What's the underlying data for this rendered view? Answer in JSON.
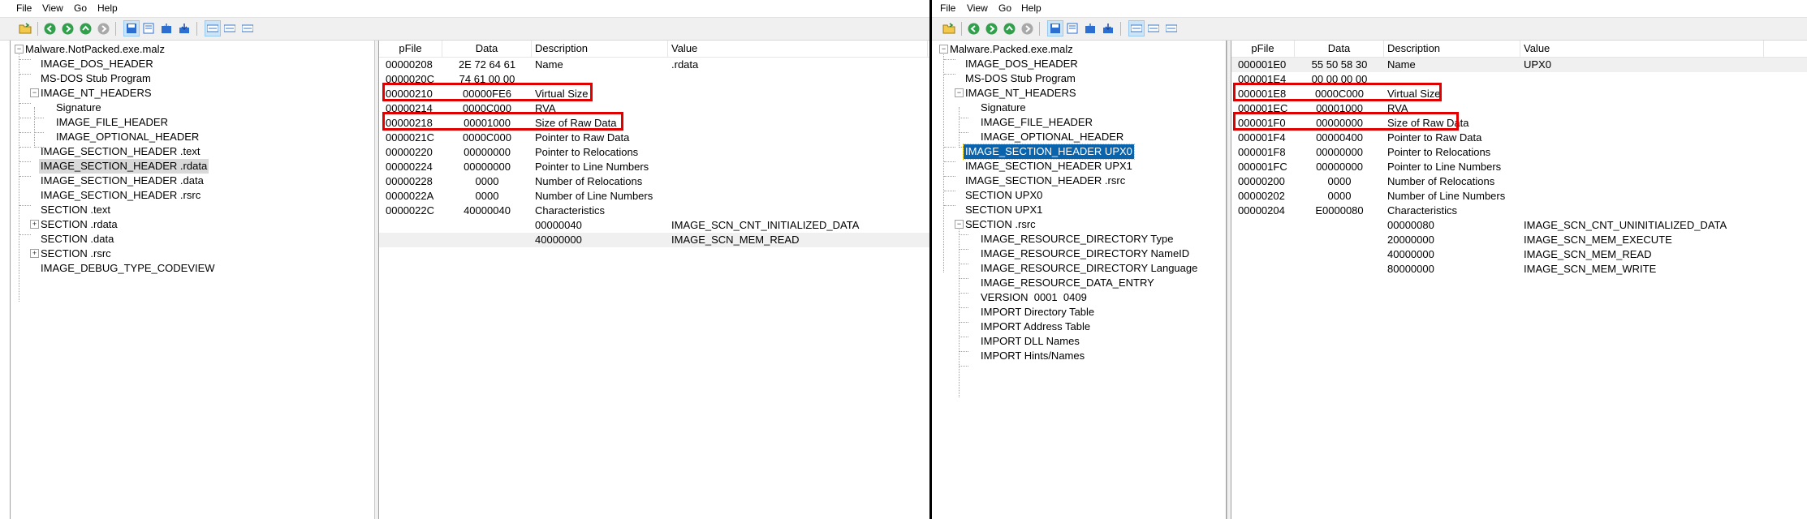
{
  "left": {
    "menu": [
      "File",
      "View",
      "Go",
      "Help"
    ],
    "tree": [
      {
        "label": "Malware.NotPacked.exe.malz",
        "level": 0,
        "expander": "−"
      },
      {
        "label": "IMAGE_DOS_HEADER",
        "level": 1
      },
      {
        "label": "MS-DOS Stub Program",
        "level": 1
      },
      {
        "label": "IMAGE_NT_HEADERS",
        "level": 1,
        "expander": "−"
      },
      {
        "label": "Signature",
        "level": 2
      },
      {
        "label": "IMAGE_FILE_HEADER",
        "level": 2
      },
      {
        "label": "IMAGE_OPTIONAL_HEADER",
        "level": 2
      },
      {
        "label": "IMAGE_SECTION_HEADER .text",
        "level": 1
      },
      {
        "label": "IMAGE_SECTION_HEADER .rdata",
        "level": 1
      },
      {
        "label": "IMAGE_SECTION_HEADER .data",
        "level": 1
      },
      {
        "label": "IMAGE_SECTION_HEADER .rsrc",
        "level": 1
      },
      {
        "label": "SECTION .text",
        "level": 1
      },
      {
        "label": "SECTION .rdata",
        "level": 1,
        "expander": "+"
      },
      {
        "label": "SECTION .data",
        "level": 1
      },
      {
        "label": "SECTION .rsrc",
        "level": 1,
        "expander": "+"
      },
      {
        "label": "IMAGE_DEBUG_TYPE_CODEVIEW",
        "level": 1
      }
    ],
    "columns": [
      "pFile",
      "Data",
      "Description",
      "Value"
    ],
    "rows": [
      {
        "pfile": "00000208",
        "data": "2E 72 64 61",
        "desc": "Name",
        "value": ".rdata"
      },
      {
        "pfile": "0000020C",
        "data": "74 61 00 00",
        "desc": "",
        "value": ""
      },
      {
        "pfile": "00000210",
        "data": "00000FE6",
        "desc": "Virtual Size",
        "value": ""
      },
      {
        "pfile": "00000214",
        "data": "0000C000",
        "desc": "RVA",
        "value": ""
      },
      {
        "pfile": "00000218",
        "data": "00001000",
        "desc": "Size of Raw Data",
        "value": ""
      },
      {
        "pfile": "0000021C",
        "data": "0000C000",
        "desc": "Pointer to Raw Data",
        "value": ""
      },
      {
        "pfile": "00000220",
        "data": "00000000",
        "desc": "Pointer to Relocations",
        "value": ""
      },
      {
        "pfile": "00000224",
        "data": "00000000",
        "desc": "Pointer to Line Numbers",
        "value": ""
      },
      {
        "pfile": "00000228",
        "data": "0000",
        "desc": "Number of Relocations",
        "value": ""
      },
      {
        "pfile": "0000022A",
        "data": "0000",
        "desc": "Number of Line Numbers",
        "value": ""
      },
      {
        "pfile": "0000022C",
        "data": "40000040",
        "desc": "Characteristics",
        "value": ""
      },
      {
        "pfile": "",
        "data": "",
        "desc": "00000040",
        "value": "IMAGE_SCN_CNT_INITIALIZED_DATA"
      },
      {
        "pfile": "",
        "data": "",
        "desc": "40000000",
        "value": "IMAGE_SCN_MEM_READ"
      }
    ]
  },
  "right": {
    "menu": [
      "File",
      "View",
      "Go",
      "Help"
    ],
    "tree": [
      {
        "label": "Malware.Packed.exe.malz",
        "level": 0,
        "expander": "−"
      },
      {
        "label": "IMAGE_DOS_HEADER",
        "level": 1
      },
      {
        "label": "MS-DOS Stub Program",
        "level": 1
      },
      {
        "label": "IMAGE_NT_HEADERS",
        "level": 1,
        "expander": "−"
      },
      {
        "label": "Signature",
        "level": 2
      },
      {
        "label": "IMAGE_FILE_HEADER",
        "level": 2
      },
      {
        "label": "IMAGE_OPTIONAL_HEADER",
        "level": 2
      },
      {
        "label": "IMAGE_SECTION_HEADER UPX0",
        "level": 1
      },
      {
        "label": "IMAGE_SECTION_HEADER UPX1",
        "level": 1
      },
      {
        "label": "IMAGE_SECTION_HEADER .rsrc",
        "level": 1
      },
      {
        "label": "SECTION UPX0",
        "level": 1
      },
      {
        "label": "SECTION UPX1",
        "level": 1
      },
      {
        "label": "SECTION .rsrc",
        "level": 1,
        "expander": "−"
      },
      {
        "label": "IMAGE_RESOURCE_DIRECTORY Type",
        "level": 2
      },
      {
        "label": "IMAGE_RESOURCE_DIRECTORY NameID",
        "level": 2
      },
      {
        "label": "IMAGE_RESOURCE_DIRECTORY Language",
        "level": 2
      },
      {
        "label": "IMAGE_RESOURCE_DATA_ENTRY",
        "level": 2
      },
      {
        "label": "VERSION  0001  0409",
        "level": 2
      },
      {
        "label": "IMPORT Directory Table",
        "level": 2
      },
      {
        "label": "IMPORT Address Table",
        "level": 2
      },
      {
        "label": "IMPORT DLL Names",
        "level": 2
      },
      {
        "label": "IMPORT Hints/Names",
        "level": 2
      }
    ],
    "columns": [
      "pFile",
      "Data",
      "Description",
      "Value"
    ],
    "rows": [
      {
        "pfile": "000001E0",
        "data": "55 50 58 30",
        "desc": "Name",
        "value": "UPX0"
      },
      {
        "pfile": "000001E4",
        "data": "00 00 00 00",
        "desc": "",
        "value": ""
      },
      {
        "pfile": "000001E8",
        "data": "0000C000",
        "desc": "Virtual Size",
        "value": ""
      },
      {
        "pfile": "000001EC",
        "data": "00001000",
        "desc": "RVA",
        "value": ""
      },
      {
        "pfile": "000001F0",
        "data": "00000000",
        "desc": "Size of Raw Data",
        "value": ""
      },
      {
        "pfile": "000001F4",
        "data": "00000400",
        "desc": "Pointer to Raw Data",
        "value": ""
      },
      {
        "pfile": "000001F8",
        "data": "00000000",
        "desc": "Pointer to Relocations",
        "value": ""
      },
      {
        "pfile": "000001FC",
        "data": "00000000",
        "desc": "Pointer to Line Numbers",
        "value": ""
      },
      {
        "pfile": "00000200",
        "data": "0000",
        "desc": "Number of Relocations",
        "value": ""
      },
      {
        "pfile": "00000202",
        "data": "0000",
        "desc": "Number of Line Numbers",
        "value": ""
      },
      {
        "pfile": "00000204",
        "data": "E0000080",
        "desc": "Characteristics",
        "value": ""
      },
      {
        "pfile": "",
        "data": "",
        "desc": "00000080",
        "value": "IMAGE_SCN_CNT_UNINITIALIZED_DATA"
      },
      {
        "pfile": "",
        "data": "",
        "desc": "20000000",
        "value": "IMAGE_SCN_MEM_EXECUTE"
      },
      {
        "pfile": "",
        "data": "",
        "desc": "40000000",
        "value": "IMAGE_SCN_MEM_READ"
      },
      {
        "pfile": "",
        "data": "",
        "desc": "80000000",
        "value": "IMAGE_SCN_MEM_WRITE"
      }
    ]
  }
}
